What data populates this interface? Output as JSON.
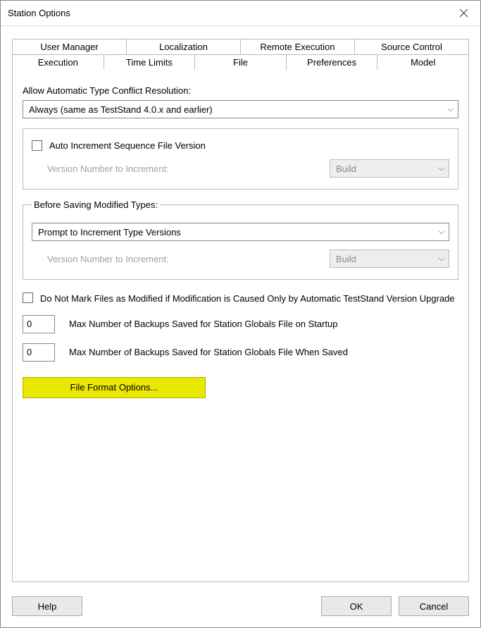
{
  "window": {
    "title": "Station Options"
  },
  "tabs_row1": [
    "User Manager",
    "Localization",
    "Remote Execution",
    "Source Control"
  ],
  "tabs_row2": [
    "Execution",
    "Time Limits",
    "File",
    "Preferences",
    "Model"
  ],
  "active_tab": "File",
  "file_panel": {
    "conflict_label": "Allow Automatic Type Conflict Resolution:",
    "conflict_value": "Always (same as TestStand 4.0.x and earlier)",
    "auto_inc_checkbox": "Auto Increment Sequence File Version",
    "version_label": "Version Number to Increment:",
    "version_value": "Build",
    "before_save_legend": "Before Saving Modified Types:",
    "before_save_value": "Prompt to Increment Type Versions",
    "before_save_version_label": "Version Number to Increment:",
    "before_save_version_value": "Build",
    "do_not_mark_label": "Do Not Mark Files as Modified if Modification is Caused Only by Automatic TestStand Version Upgrade",
    "max_startup": {
      "value": "0",
      "label": "Max Number of Backups Saved for Station Globals File on Startup"
    },
    "max_saved": {
      "value": "0",
      "label": "Max Number of Backups Saved for Station Globals File When Saved"
    },
    "file_format_btn": "File Format Options..."
  },
  "footer": {
    "help": "Help",
    "ok": "OK",
    "cancel": "Cancel"
  }
}
